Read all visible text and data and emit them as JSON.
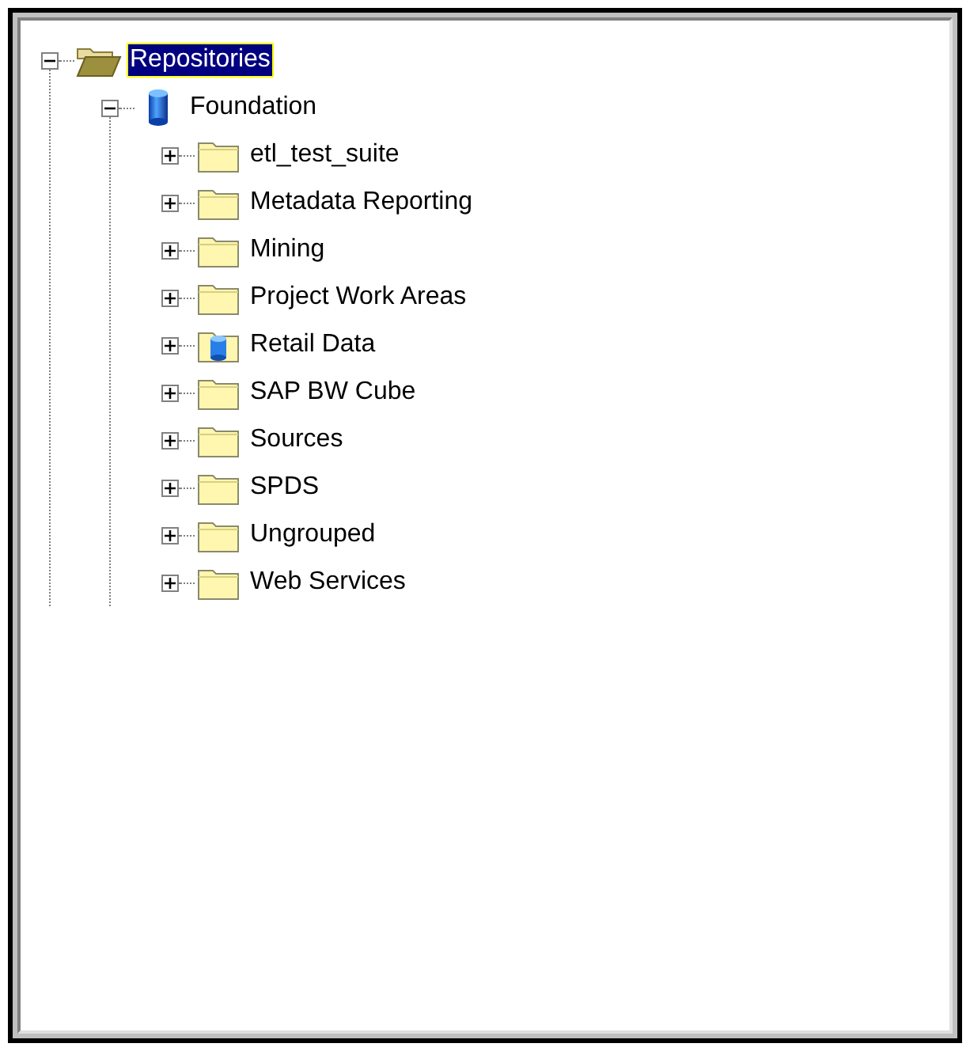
{
  "tree": [
    {
      "label": "Repositories",
      "kind": "open-folder",
      "expanded": true,
      "selected": true,
      "children": [
        {
          "label": "Foundation",
          "kind": "database",
          "expanded": true,
          "selected": false,
          "children": [
            {
              "label": "etl_test_suite",
              "kind": "folder",
              "expanded": false,
              "selected": false
            },
            {
              "label": "Metadata Reporting",
              "kind": "folder",
              "expanded": false,
              "selected": false
            },
            {
              "label": "Mining",
              "kind": "folder",
              "expanded": false,
              "selected": false
            },
            {
              "label": "Project Work Areas",
              "kind": "folder",
              "expanded": false,
              "selected": false
            },
            {
              "label": "Retail Data",
              "kind": "database-folder",
              "expanded": false,
              "selected": false
            },
            {
              "label": "SAP BW Cube",
              "kind": "folder",
              "expanded": false,
              "selected": false
            },
            {
              "label": "Sources",
              "kind": "folder",
              "expanded": false,
              "selected": false
            },
            {
              "label": "SPDS",
              "kind": "folder",
              "expanded": false,
              "selected": false
            },
            {
              "label": "Ungrouped",
              "kind": "folder",
              "expanded": false,
              "selected": false
            },
            {
              "label": "Web Services",
              "kind": "folder",
              "expanded": false,
              "selected": false
            }
          ]
        }
      ]
    }
  ]
}
